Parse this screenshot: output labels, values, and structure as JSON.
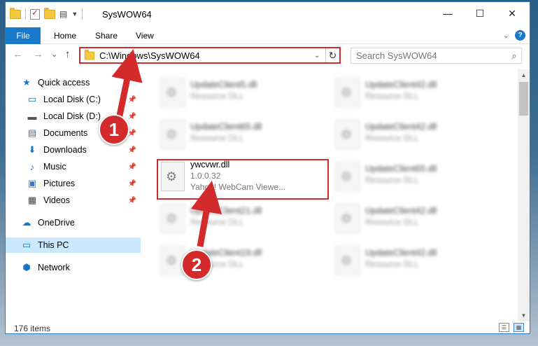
{
  "window": {
    "title": "SysWOW64",
    "controls": {
      "minimize": "—",
      "maximize": "☐",
      "close": "✕"
    }
  },
  "ribbon": {
    "tabs": [
      "File",
      "Home",
      "Share",
      "View"
    ],
    "expand_icon": "chevron-down-icon",
    "help_label": "?"
  },
  "navigation": {
    "back": "←",
    "forward": "→",
    "recent": "⌄",
    "up": "↑",
    "address": "C:\\Windows\\SysWOW64",
    "address_dropdown": "⌄",
    "refresh": "↻",
    "search_placeholder": "Search SysWOW64",
    "search_icon": "⌕"
  },
  "sidebar": {
    "items": [
      {
        "label": "Quick access",
        "icon": "★",
        "pinned": false
      },
      {
        "label": "Local Disk (C:)",
        "icon": "▭",
        "pinned": true
      },
      {
        "label": "Local Disk (D:)",
        "icon": "▬",
        "pinned": true
      },
      {
        "label": "Documents",
        "icon": "▤",
        "pinned": true
      },
      {
        "label": "Downloads",
        "icon": "⬇",
        "pinned": true
      },
      {
        "label": "Music",
        "icon": "♪",
        "pinned": true
      },
      {
        "label": "Pictures",
        "icon": "▣",
        "pinned": true
      },
      {
        "label": "Videos",
        "icon": "▦",
        "pinned": true
      },
      {
        "label": "OneDrive",
        "icon": "☁",
        "pinned": false
      },
      {
        "label": "This PC",
        "icon": "▭",
        "pinned": false
      },
      {
        "label": "Network",
        "icon": "⬢",
        "pinned": false
      }
    ],
    "pin_icon": "📌"
  },
  "files": {
    "left_column": [
      {
        "name": "UpdateClient5.dll",
        "subtitle": "Resource DLL"
      },
      {
        "name": "UpdateClient65.dll",
        "subtitle": "Resource DLL"
      },
      {
        "name": "ywcvwr.dll",
        "version": "1.0.0.32",
        "description": "Yahoo! WebCam Viewe..."
      },
      {
        "name": "UpdateClient21.dll",
        "subtitle": "Resource DLL"
      },
      {
        "name": "UpdateClient19.dll",
        "subtitle": "Resource DLL"
      }
    ],
    "right_column": [
      {
        "name": "UpdateClient42.dll",
        "subtitle": "Resource DLL"
      },
      {
        "name": "UpdateClient42.dll",
        "subtitle": "Resource DLL"
      },
      {
        "name": "UpdateClient65.dll",
        "subtitle": "Resource DLL"
      },
      {
        "name": "UpdateClient42.dll",
        "subtitle": "Resource DLL"
      },
      {
        "name": "UpdateClient42.dll",
        "subtitle": "Resource DLL"
      }
    ]
  },
  "status": {
    "item_count": "176 items"
  },
  "annotations": {
    "callout_1": "1",
    "callout_2": "2",
    "color": "#d32b2b"
  }
}
